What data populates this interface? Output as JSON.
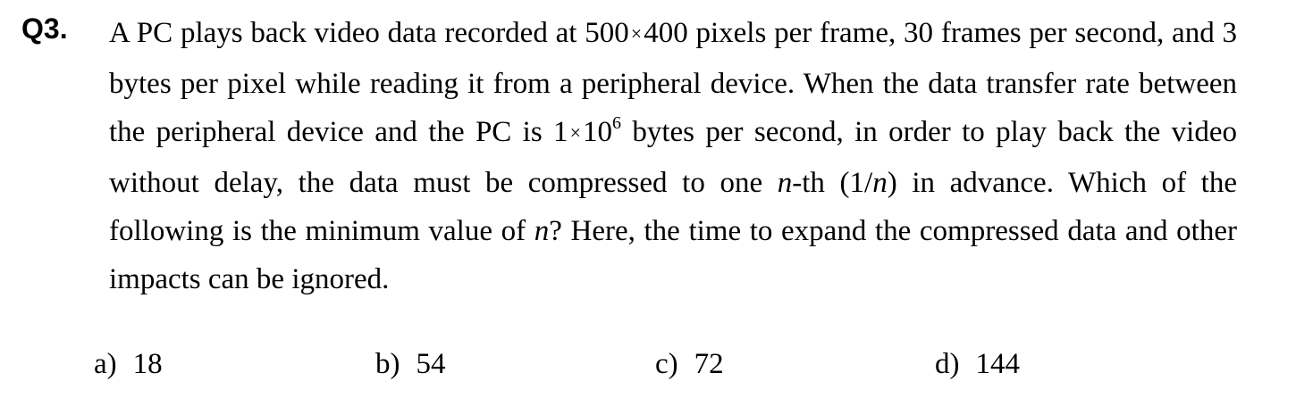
{
  "question": {
    "number": "Q3.",
    "text_parts": {
      "p1": "A PC plays back video data recorded at 500",
      "times": "×",
      "p2": "400 pixels per frame, 30 frames per second, and 3 bytes per pixel while reading it from a peripheral device.    When the data transfer rate between the peripheral device and the PC is 1",
      "p3": "10",
      "exponent": "6",
      "p4": " bytes per second, in order to play back the video without delay, the data must be compressed to one ",
      "n1": "n",
      "p5": "-th (1/",
      "n2": "n",
      "p6": ") in advance. Which of the following is the minimum value of ",
      "n3": "n",
      "p7": "?   Here, the time to expand the compressed data and other impacts can be ignored."
    }
  },
  "choices": [
    {
      "letter": "a)",
      "value": "18"
    },
    {
      "letter": "b)",
      "value": "54"
    },
    {
      "letter": "c)",
      "value": "72"
    },
    {
      "letter": "d)",
      "value": "144"
    }
  ]
}
